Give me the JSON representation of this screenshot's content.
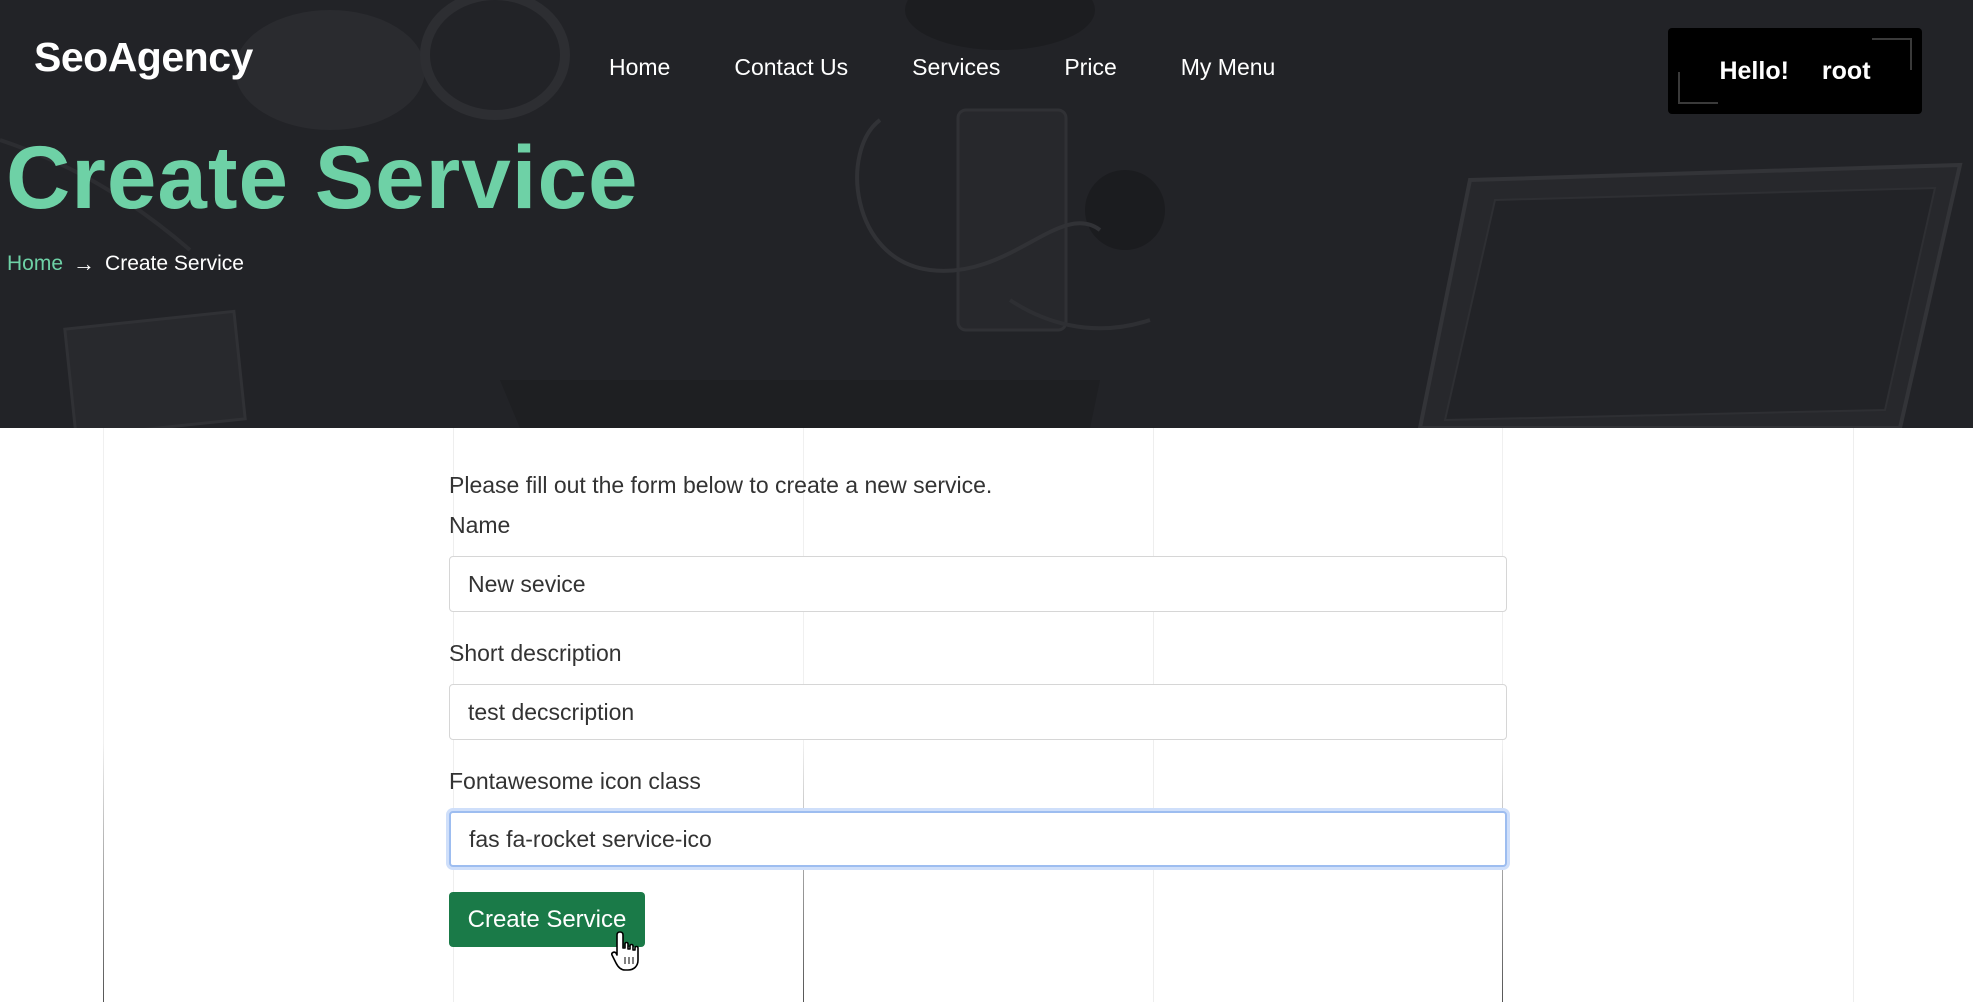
{
  "header": {
    "logo": "SeoAgency",
    "nav": [
      {
        "label": "Home"
      },
      {
        "label": "Contact Us"
      },
      {
        "label": "Services"
      },
      {
        "label": "Price"
      },
      {
        "label": "My Menu"
      }
    ],
    "user": {
      "greeting": "Hello!",
      "name": "root"
    }
  },
  "hero": {
    "title": "Create Service",
    "breadcrumb": {
      "home": "Home",
      "separator": "→",
      "current": "Create Service"
    }
  },
  "form": {
    "intro": "Please fill out the form below to create a new service.",
    "name": {
      "label": "Name",
      "value": "New sevice"
    },
    "short_description": {
      "label": "Short description",
      "value": "test decscription"
    },
    "icon_class": {
      "label": "Fontawesome icon class",
      "value": "fas fa-rocket service-ico"
    },
    "submit_label": "Create Service"
  },
  "colors": {
    "accent": "#6ed1a6",
    "hero_bg": "#222327",
    "button": "#1a7a48",
    "focus": "#9dbdf0"
  }
}
